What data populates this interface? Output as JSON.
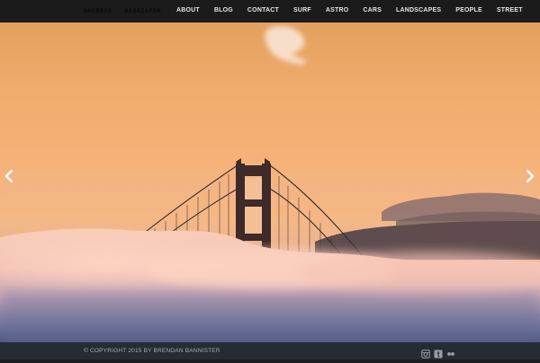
{
  "site": {
    "logo_text": {
      "first": "BRENDAN",
      "last": "BANNISTER"
    }
  },
  "nav": {
    "items": [
      {
        "label": "ABOUT"
      },
      {
        "label": "BLOG"
      },
      {
        "label": "CONTACT"
      },
      {
        "label": "SURF"
      },
      {
        "label": "ASTRO"
      },
      {
        "label": "CARS"
      },
      {
        "label": "LANDSCAPES"
      },
      {
        "label": "PEOPLE"
      },
      {
        "label": "STREET"
      }
    ]
  },
  "slider": {
    "prev_icon": "chevron-left-icon",
    "next_icon": "chevron-right-icon"
  },
  "footer": {
    "copyright": "© COPYRIGHT 2015 BY BRENDAN BANNISTER",
    "social_icons": [
      "instagram-icon",
      "tumblr-icon",
      "flickr-icon"
    ]
  },
  "colors": {
    "topbar": "#1b1b1b",
    "footer": "#262c34",
    "sky_top": "#e0a060",
    "sky_mid": "#f4b277",
    "fog": "#f6c8b7"
  }
}
